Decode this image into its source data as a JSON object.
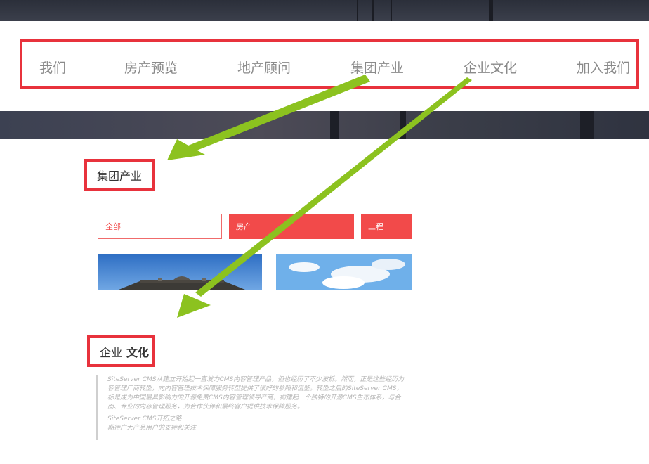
{
  "nav": {
    "items": [
      {
        "label": "我们"
      },
      {
        "label": "房产预览"
      },
      {
        "label": "地产顾问"
      },
      {
        "label": "集团产业"
      },
      {
        "label": "企业文化"
      },
      {
        "label": "加入我们"
      }
    ]
  },
  "industry": {
    "title": "集团产业",
    "filters": [
      {
        "label": "全部"
      },
      {
        "label": "房产"
      },
      {
        "label": "工程"
      }
    ]
  },
  "culture": {
    "title_prefix": "企业",
    "title_bold": "文化",
    "paragraph_lines": [
      "SiteServer CMS从建立开始起一直发力CMS内容管理产品，但也经历了不少波折。然而，正是这些经历为",
      "容管理厂商转型，向内容管理技术保障服务转型提供了很好的参照和借鉴。转型之后的SiteServer CMS，",
      "标是成为中国最具影响力的开源免费CMS内容管理领导产商，构建起一个独特的开源CMS生态体系，与合",
      "面、专业的内容管理服务，为合作伙伴和最终客户提供技术保障服务。"
    ],
    "footer_lines": [
      "SiteServer CMS开拓之路",
      "期待广大产品用户的支持和关注"
    ]
  },
  "colors": {
    "highlight_red": "#e8323c",
    "arrow_green": "#8cc21f",
    "tab_red": "#f24a4a"
  }
}
